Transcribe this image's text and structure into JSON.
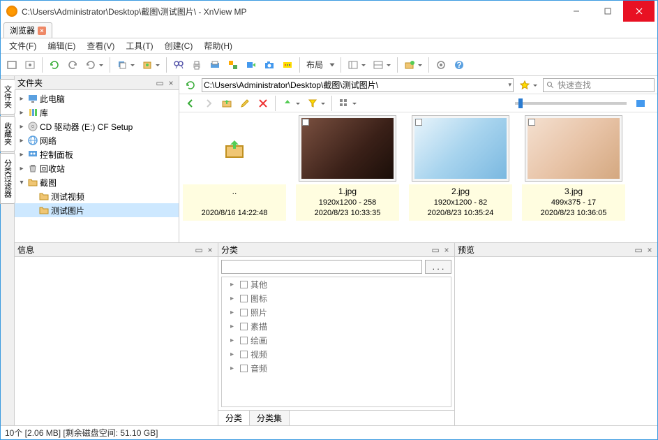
{
  "window": {
    "title": "C:\\Users\\Administrator\\Desktop\\截图\\测试图片\\ - XnView MP"
  },
  "tabs": {
    "browser": "浏览器"
  },
  "menu": {
    "file": "文件(F)",
    "edit": "编辑(E)",
    "view": "查看(V)",
    "tools": "工具(T)",
    "create": "创建(C)",
    "help": "帮助(H)"
  },
  "toolbar": {
    "layout": "布局"
  },
  "panels": {
    "folders": "文件夹",
    "info": "信息",
    "categories": "分类",
    "preview": "预览"
  },
  "sidetabs": {
    "folders": "文件夹",
    "favorites": "收藏夹",
    "catfilter": "分类过滤器"
  },
  "address": {
    "path": "C:\\Users\\Administrator\\Desktop\\截图\\测试图片\\",
    "search_placeholder": "快速查找"
  },
  "tree": {
    "items": [
      {
        "label": "此电脑",
        "icon": "pc"
      },
      {
        "label": "库",
        "icon": "lib"
      },
      {
        "label": "CD 驱动器 (E:) CF Setup",
        "icon": "cd"
      },
      {
        "label": "网络",
        "icon": "net"
      },
      {
        "label": "控制面板",
        "icon": "cpl"
      },
      {
        "label": "回收站",
        "icon": "bin"
      },
      {
        "label": "截图",
        "icon": "folder",
        "expanded": true,
        "children": [
          {
            "label": "测试视频",
            "icon": "folder"
          },
          {
            "label": "测试图片",
            "icon": "folder",
            "selected": true
          }
        ]
      }
    ]
  },
  "thumbs": {
    "updir": {
      "line3": "2020/8/16 14:22:48",
      "name": ".."
    },
    "items": [
      {
        "name": "1.jpg",
        "dims": "1920x1200 - 258",
        "date": "2020/8/23 10:33:35"
      },
      {
        "name": "2.jpg",
        "dims": "1920x1200 - 82",
        "date": "2020/8/23 10:35:24"
      },
      {
        "name": "3.jpg",
        "dims": "499x375 - 17",
        "date": "2020/8/23 10:36:05"
      }
    ]
  },
  "categories": {
    "filter_button": ". . .",
    "items": [
      "其他",
      "图标",
      "照片",
      "素描",
      "绘画",
      "视频",
      "音频"
    ],
    "tab_cat": "分类",
    "tab_catset": "分类集"
  },
  "status": "10个 [2.06 MB] [剩余磁盘空间: 51.10 GB]"
}
